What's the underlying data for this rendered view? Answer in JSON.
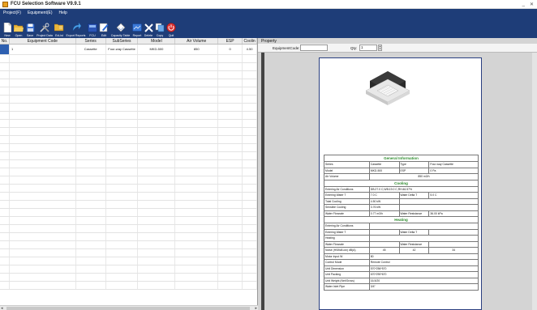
{
  "window": {
    "title": "FCU Selection Software V9.9.1",
    "min": "_",
    "close": "✕"
  },
  "menu": [
    "Project(F)",
    "Equipment(E)",
    "Help"
  ],
  "toolbar": [
    {
      "label": "New",
      "icon": "new-doc-icon",
      "w": ""
    },
    {
      "label": "Open",
      "icon": "open-folder-icon",
      "w": ""
    },
    {
      "label": "Save",
      "icon": "save-icon",
      "w": ""
    },
    {
      "label": "Project Data",
      "icon": "tools-icon",
      "w": "wide"
    },
    {
      "label": "ExList",
      "icon": "export-list-icon",
      "w": ""
    },
    {
      "label": "Export Reports",
      "icon": "export-reports-icon",
      "w": "wider"
    },
    {
      "label": "FCU",
      "icon": "fcu-icon",
      "w": ""
    },
    {
      "label": "Edit",
      "icon": "edit-icon",
      "w": ""
    },
    {
      "label": "Capacity Table",
      "icon": "capacity-table-icon",
      "w": "wider"
    },
    {
      "label": "Report",
      "icon": "report-icon",
      "w": ""
    },
    {
      "label": "Delete",
      "icon": "delete-icon",
      "w": ""
    },
    {
      "label": "Copy",
      "icon": "copy-icon",
      "w": ""
    },
    {
      "label": "Quit",
      "icon": "quit-icon",
      "w": ""
    }
  ],
  "grid": {
    "columns": [
      "No.",
      "Equipment Code",
      "Series",
      "SubSeries",
      "Model",
      "Air Volume",
      "ESP",
      "Coolin"
    ],
    "rows": [
      {
        "no": "1",
        "code": "",
        "series": "Cassette",
        "subseries": "Four-way Cassette",
        "model": "MKD-500",
        "air": "850",
        "esp": "0",
        "cool": "4.50"
      }
    ]
  },
  "property": {
    "title": "Property",
    "equipment_code_label": "EquipmentCode:",
    "equipment_code_value": "",
    "qty_label": "Qty:",
    "qty_value": "1"
  },
  "report": {
    "general_title": "General Information",
    "series_label": "Series",
    "series_value": "Cassette",
    "type_label": "Type",
    "type_value": "Four-way Cassette",
    "model_label": "Model",
    "model_value": "MKD-500",
    "esp_label": "ESP",
    "esp_value": "0 Pa",
    "air_label": "Air Volume",
    "air_value": "850 m3/h",
    "cooling_title": "Cooling",
    "eac_label": "Entering Air Conditions",
    "eac_value": "DB:27.0 C,WB:19.0 C,RH:46.57%",
    "ewt_label": "Entering Water T",
    "ewt_value": "7.0 C",
    "wdt_label": "Water Delta T",
    "wdt_value": "5.0 C",
    "tc_label": "Total Cooling",
    "tc_value": "4.50 kW",
    "sc_label": "Sensible Cooling",
    "sc_value": "3.76 kW",
    "wf_label": "Water Flowrate",
    "wf_value": "0.77 m3/h",
    "wr_label": "Water Resistance",
    "wr_value": "36.00 kPa",
    "heating_title": "Heating",
    "h_eac_label": "Entering Air Conditions",
    "h_ewt_label": "Entering Water T",
    "h_wdt_label": "Water Delta T",
    "h_heating_label": "Heating",
    "h_wf_label": "Water Flowrate",
    "h_wr_label": "Water Resistance",
    "noise_label": "Noise (H/Mid/Low)  dB(A)",
    "noise_h": "45",
    "noise_m": "42",
    "noise_l": "34",
    "motor_label": "Motor Input    W",
    "motor_value": "80",
    "ctrl_label": "Control Mode",
    "ctrl_value": "Remote Control",
    "dim_label": "Unit Dimension",
    "dim_value": "570*256*570",
    "pack_label": "Unit Packing",
    "pack_value": "670*290*670",
    "weight_label": "Unit Weight (Net/Gross)",
    "weight_value": "16.5/20",
    "pipe_label": "Water Inlet Pipe",
    "pipe_value": "3/4\""
  }
}
